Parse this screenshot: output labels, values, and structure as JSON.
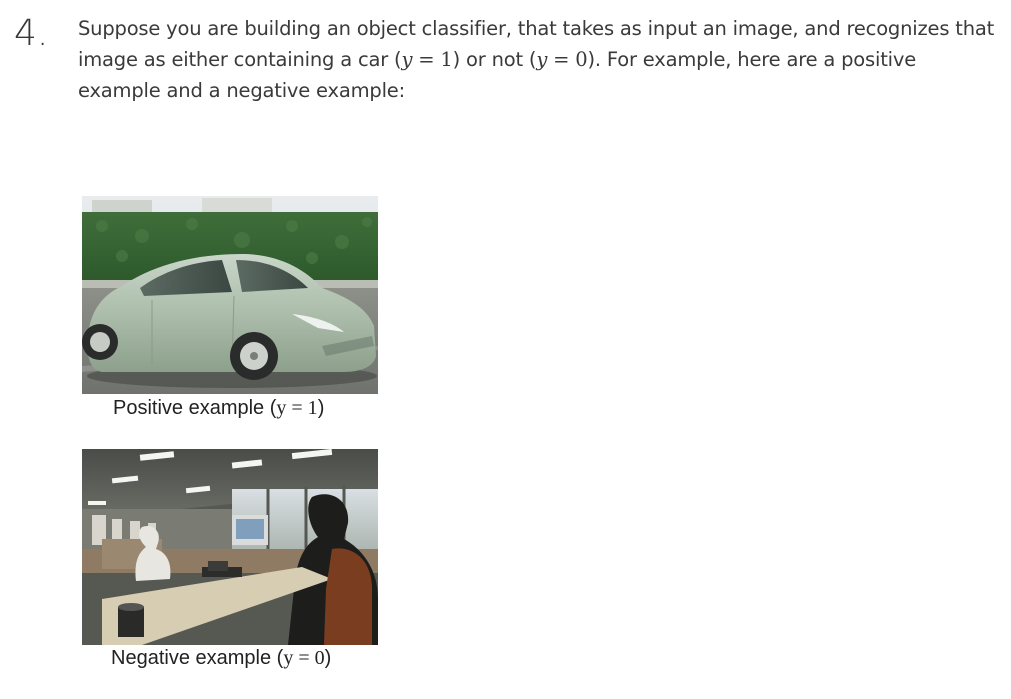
{
  "question": {
    "number": "4.",
    "text_1": "Suppose you are building an object classifier, that takes as input an image, and recognizes that image as either containing a car (",
    "math_1_var": "y",
    "math_1_rest": " = 1",
    "text_2": ") or not (",
    "math_2_var": "y",
    "math_2_rest": " = 0",
    "text_3": "). For example, here are a positive example and a negative example:"
  },
  "positive": {
    "caption_text": "Positive example (",
    "caption_math": "y = 1",
    "caption_close": ")"
  },
  "negative": {
    "caption_text": "Negative example (",
    "caption_math": "y = 0",
    "caption_close": ")"
  }
}
